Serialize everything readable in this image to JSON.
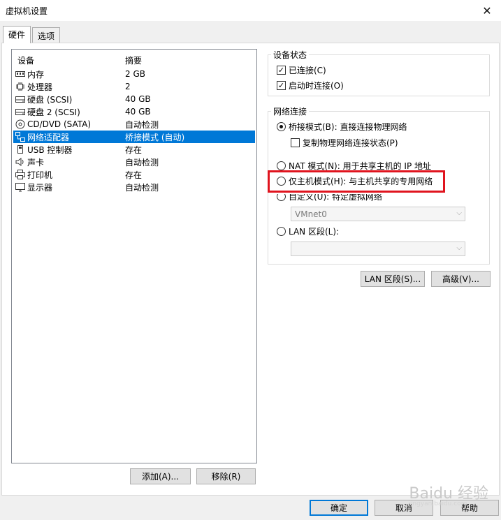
{
  "window": {
    "title": "虚拟机设置",
    "close_label": "✕"
  },
  "tabs": [
    {
      "label": "硬件",
      "active": true
    },
    {
      "label": "选项",
      "active": false
    }
  ],
  "devices": {
    "headers": {
      "device": "设备",
      "summary": "摘要"
    },
    "items": [
      {
        "name": "内存",
        "summary": "2 GB",
        "icon": "memory-icon"
      },
      {
        "name": "处理器",
        "summary": "2",
        "icon": "processor-icon"
      },
      {
        "name": "硬盘 (SCSI)",
        "summary": "40 GB",
        "icon": "hard-disk-icon"
      },
      {
        "name": "硬盘 2 (SCSI)",
        "summary": "40 GB",
        "icon": "hard-disk-icon"
      },
      {
        "name": "CD/DVD (SATA)",
        "summary": "自动检测",
        "icon": "cd-dvd-icon"
      },
      {
        "name": "网络适配器",
        "summary": "桥接模式 (自动)",
        "icon": "network-adapter-icon",
        "selected": true
      },
      {
        "name": "USB 控制器",
        "summary": "存在",
        "icon": "usb-icon"
      },
      {
        "name": "声卡",
        "summary": "自动检测",
        "icon": "sound-card-icon"
      },
      {
        "name": "打印机",
        "summary": "存在",
        "icon": "printer-icon"
      },
      {
        "name": "显示器",
        "summary": "自动检测",
        "icon": "display-icon"
      }
    ],
    "add_label": "添加(A)...",
    "remove_label": "移除(R)"
  },
  "device_status": {
    "label": "设备状态",
    "connected": {
      "label": "已连接(C)",
      "checked": true
    },
    "connect_at_power_on": {
      "label": "启动时连接(O)",
      "checked": true
    }
  },
  "network": {
    "label": "网络连接",
    "bridged": {
      "label": "桥接模式(B): 直接连接物理网络",
      "selected": true
    },
    "replicate": {
      "label": "复制物理网络连接状态(P)",
      "checked": false
    },
    "nat": {
      "label": "NAT 模式(N): 用于共享主机的 IP 地址",
      "selected": false
    },
    "host_only": {
      "label": "仅主机模式(H): 与主机共享的专用网络",
      "selected": false
    },
    "custom": {
      "label": "自定义(U): 特定虚拟网络",
      "selected": false
    },
    "custom_value": "VMnet0",
    "lan_segment": {
      "label": "LAN 区段(L):",
      "selected": false
    },
    "lan_segment_value": ""
  },
  "actions": {
    "lan_segments_label": "LAN 区段(S)...",
    "advanced_label": "高级(V)..."
  },
  "footer": {
    "ok_label": "确定",
    "cancel_label": "取消",
    "help_label": "帮助"
  },
  "watermark": {
    "brand": "Baidu 经验",
    "url": "jingyan.baidu.com"
  },
  "colors": {
    "selection": "#0078d7",
    "highlight_box": "#e0141e"
  }
}
